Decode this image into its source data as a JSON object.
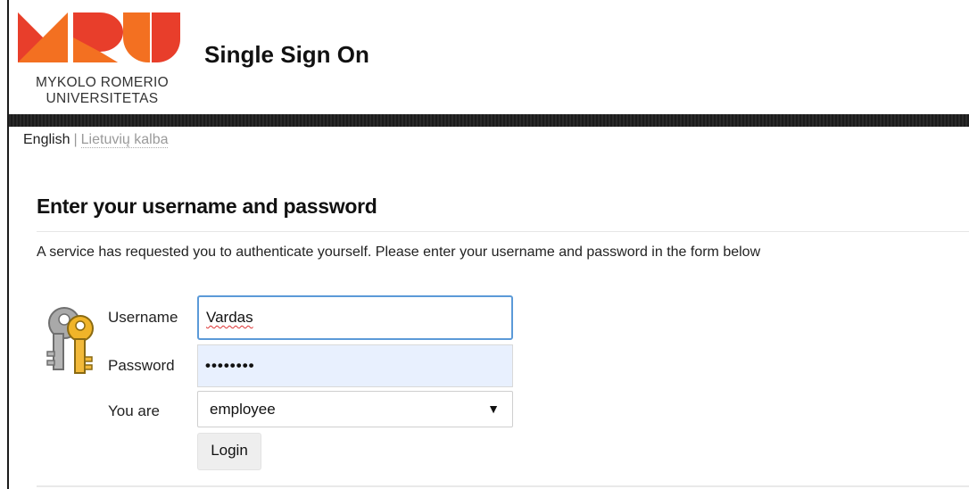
{
  "header": {
    "logo_line1": "MYKOLO ROMERIO",
    "logo_line2": "UNIVERSITETAS",
    "title": "Single Sign On"
  },
  "languages": {
    "current": "English",
    "separator": "|",
    "alternate": "Lietuvių kalba"
  },
  "form": {
    "heading": "Enter your username and password",
    "description": "A service has requested you to authenticate yourself. Please enter your username and password in the form below",
    "username_label": "Username",
    "username_value": "Vardas",
    "password_label": "Password",
    "password_mask": "••••••••",
    "role_label": "You are",
    "role_value": "employee",
    "login_label": "Login",
    "icon": "keys-icon"
  },
  "colors": {
    "logo_orange": "#f37021",
    "logo_red": "#e83e2b",
    "focus_border": "#5b9ad8",
    "autofill_bg": "#e8f0fe"
  }
}
